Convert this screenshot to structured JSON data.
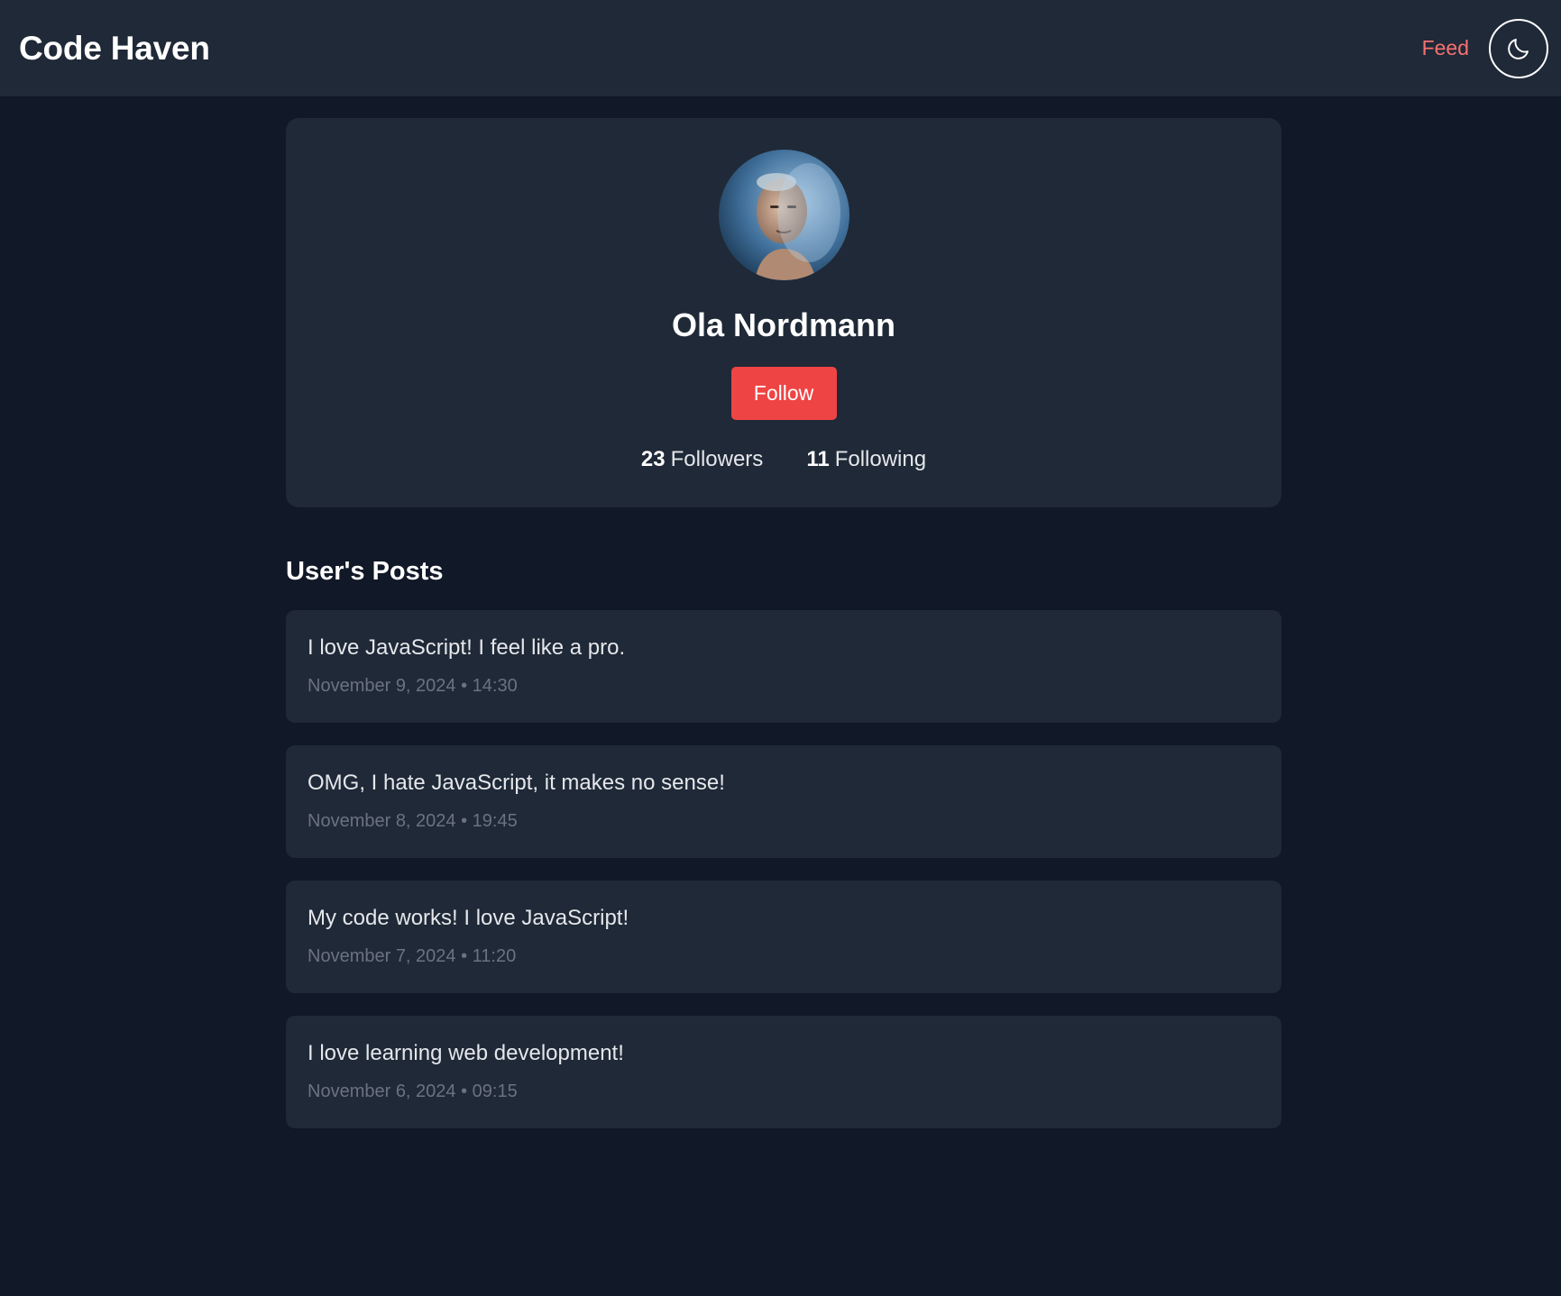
{
  "header": {
    "brand": "Code Haven",
    "nav_feed": "Feed",
    "theme_toggle_icon": "moon-icon"
  },
  "profile": {
    "name": "Ola Nordmann",
    "follow_label": "Follow",
    "followers_count": "23",
    "followers_label": "Followers",
    "following_count": "11",
    "following_label": "Following"
  },
  "posts_section": {
    "heading": "User's Posts",
    "posts": [
      {
        "text": "I love JavaScript! I feel like a pro.",
        "date": "November 9, 2024",
        "time": "14:30"
      },
      {
        "text": "OMG, I hate JavaScript, it makes no sense!",
        "date": "November 8, 2024",
        "time": "19:45"
      },
      {
        "text": "My code works! I love JavaScript!",
        "date": "November 7, 2024",
        "time": "11:20"
      },
      {
        "text": "I love learning web development!",
        "date": "November 6, 2024",
        "time": "09:15"
      }
    ]
  },
  "colors": {
    "page_bg": "#111827",
    "card_bg": "#1f2937",
    "accent": "#ef4444",
    "nav_link": "#f87171",
    "muted": "#6b7280"
  }
}
